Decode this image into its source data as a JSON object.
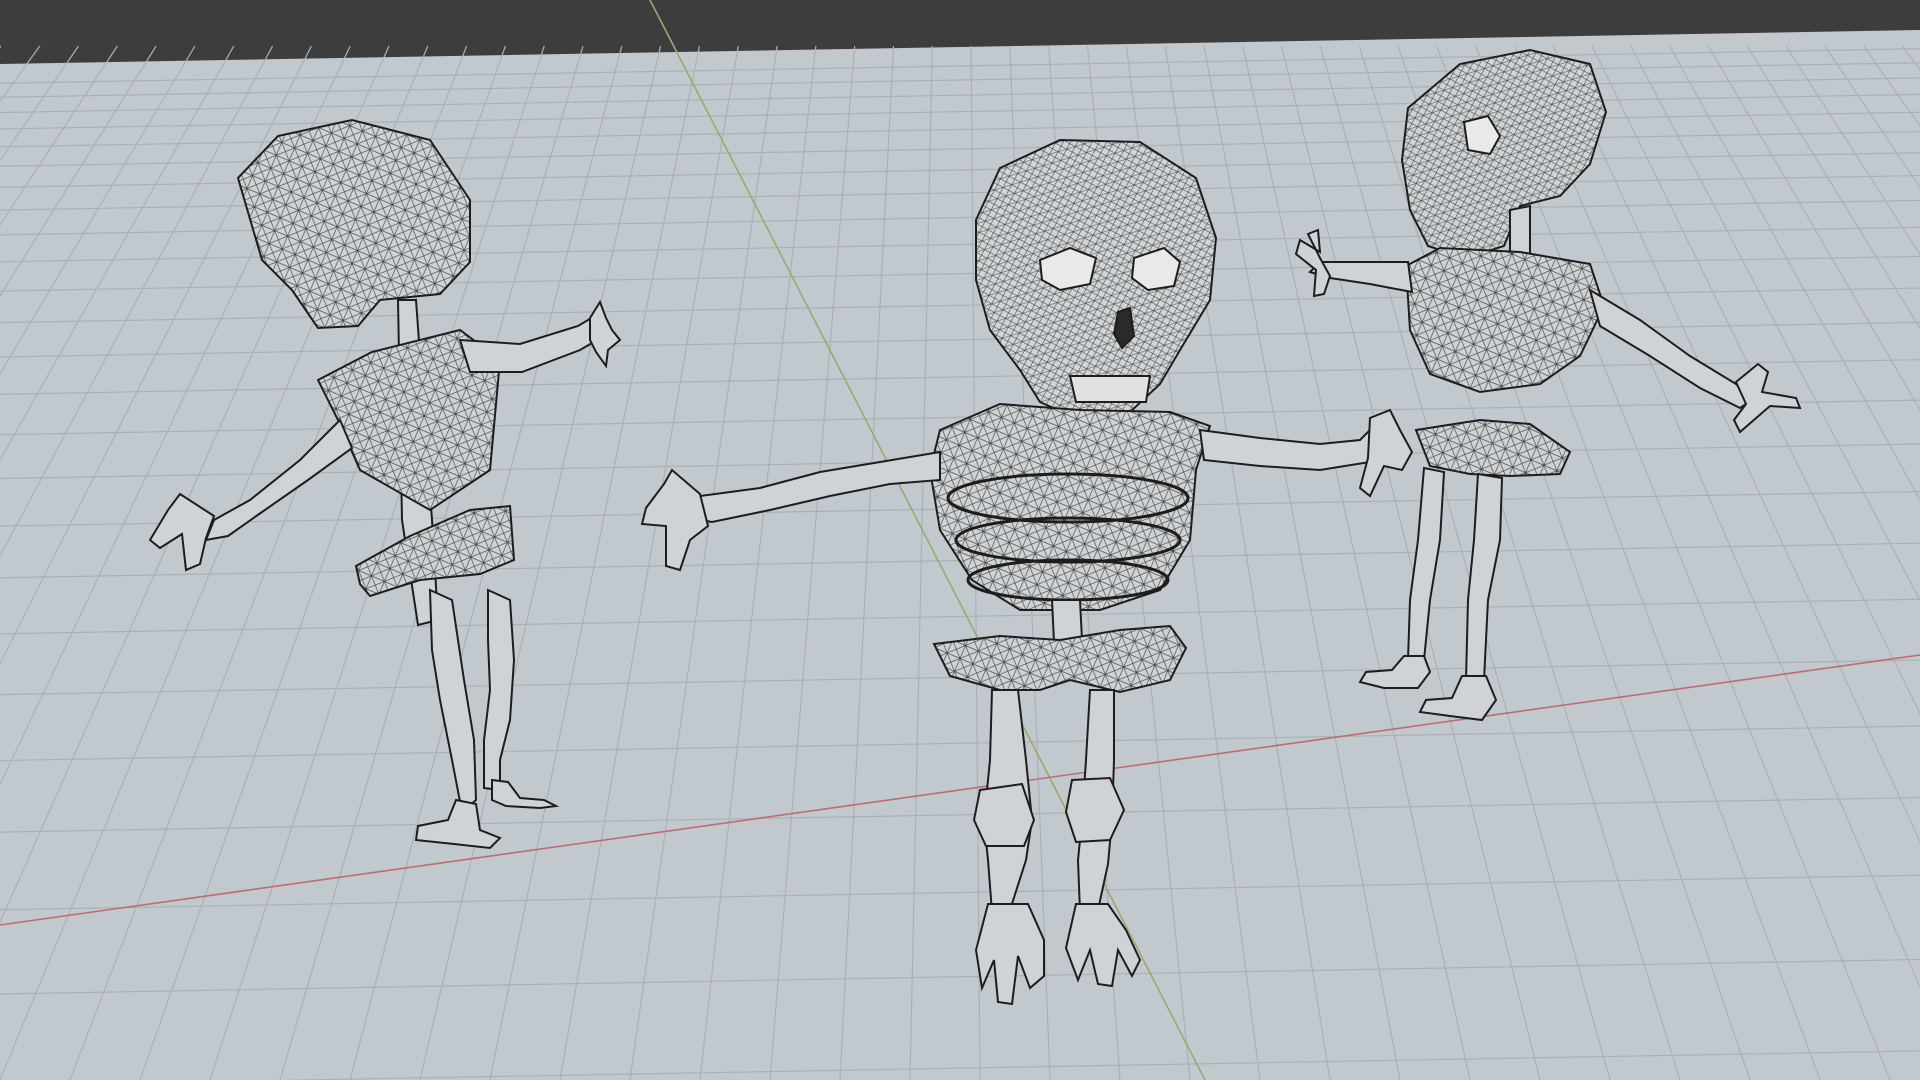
{
  "viewport": {
    "mode": "wireframe-overlay",
    "background_color": "#3d3d3d",
    "floor_color": "#c2c9ce",
    "grid_color": "#aab1b6",
    "x_axis_color": "#c06a70",
    "y_axis_color": "#97ab6e",
    "mesh_fill_color": "#d3d6d8",
    "wire_color": "#1d1d1d"
  },
  "objects": [
    {
      "name": "skeleton",
      "view": "back",
      "icon": "skeleton-mesh-icon"
    },
    {
      "name": "skeleton",
      "view": "front",
      "icon": "skeleton-mesh-icon"
    },
    {
      "name": "skeleton",
      "view": "side",
      "icon": "skeleton-mesh-icon"
    }
  ]
}
